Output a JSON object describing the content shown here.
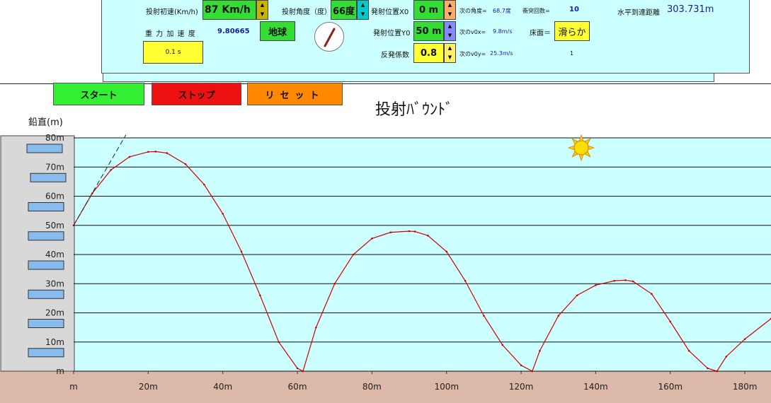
{
  "title": "投射ﾊﾞｳﾝﾄﾞ",
  "controls": {
    "velocity_label": "投射初速(Km/h)",
    "velocity_value": "87 Km/h",
    "angle_label": "投射角度（度）",
    "angle_value": "66度",
    "x0_label": "発射位置X0",
    "x0_value": "0 m",
    "y0_label": "発射位置Y0",
    "y0_value": "50 m",
    "restitution_label": "反発係数",
    "restitution_value": "0.8",
    "gravity_label": "重 力 加 速 度",
    "gravity_value": "9.80665",
    "planet_button": "地球",
    "time_step": "0.1 s",
    "next_angle_label": "次の角度=",
    "next_angle_value": "68.7度",
    "next_v0x_label": "次のv0x=",
    "next_v0x_value": "9.8m/s",
    "next_v0y_label": "次のv0y=",
    "next_v0y_value": "25.3m/s",
    "collision_label": "衝突回数=",
    "collision_value": "10",
    "floor_label": "床面＝",
    "floor_value": "滑らか",
    "extra_value": "1",
    "distance_label": "水平到達距離",
    "distance_value": "303.731m"
  },
  "buttons": {
    "start": "スタート",
    "stop": "ストップ",
    "reset": "リセット"
  },
  "colors": {
    "panel": "#ccffff",
    "start": "#33ee33",
    "stop": "#ee1111",
    "reset": "#ff8800",
    "ground": "#dcb8a8",
    "curve": "#cc0000"
  },
  "chart_data": {
    "type": "line",
    "title": "投射ﾊﾞｳﾝﾄﾞ",
    "ylabel": "鉛直(m)",
    "xlabel": "",
    "xlim": [
      0,
      187
    ],
    "ylim": [
      0,
      80
    ],
    "x_ticks": [
      "m",
      "20m",
      "40m",
      "60m",
      "80m",
      "100m",
      "120m",
      "140m",
      "160m",
      "180m"
    ],
    "y_ticks": [
      "m",
      "10m",
      "20m",
      "30m",
      "40m",
      "50m",
      "60m",
      "70m",
      "80m"
    ],
    "grid": true,
    "series": [
      {
        "x": [
          0,
          5,
          10,
          15,
          20,
          22,
          25,
          30,
          35,
          40,
          45,
          50,
          55,
          60,
          61.5,
          65,
          70,
          75,
          80,
          85,
          90,
          91.5,
          95,
          100,
          105,
          110,
          115,
          120,
          123,
          125,
          130,
          135,
          140,
          145,
          148,
          150,
          155,
          160,
          165,
          170,
          172.5,
          175,
          180,
          187
        ],
        "y": [
          50,
          61,
          69,
          73.5,
          75.2,
          75.3,
          74.8,
          71,
          64,
          54,
          41,
          26,
          10,
          1,
          0,
          15,
          30,
          40,
          45.5,
          47.6,
          48,
          47.9,
          46.5,
          41,
          31,
          19,
          9,
          2,
          0,
          7,
          19,
          26,
          29.5,
          31,
          31.2,
          30.8,
          26.5,
          17,
          7,
          1,
          0,
          5,
          11,
          18
        ]
      },
      {
        "x": [
          0,
          14
        ],
        "y": [
          50,
          81
        ]
      }
    ]
  }
}
